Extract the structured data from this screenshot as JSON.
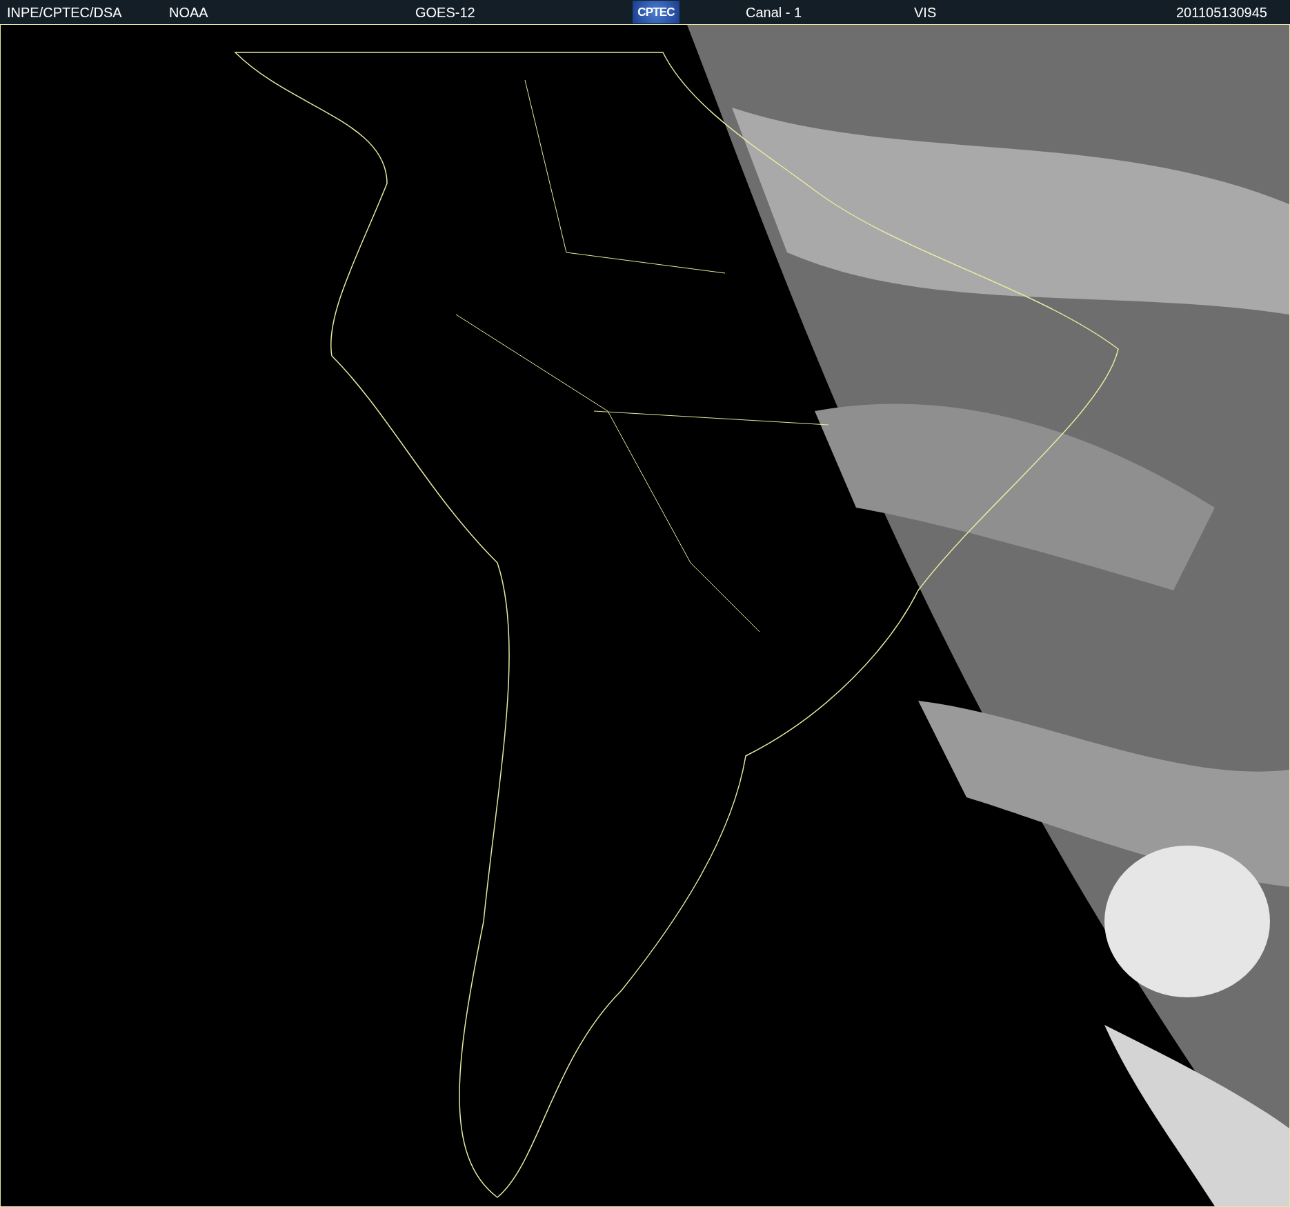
{
  "header": {
    "source": "INPE/CPTEC/DSA",
    "agency": "NOAA",
    "satellite": "GOES-12",
    "logo": "CPTEC",
    "channel": "Canal - 1",
    "band": "VIS",
    "timestamp": "201105130945"
  }
}
